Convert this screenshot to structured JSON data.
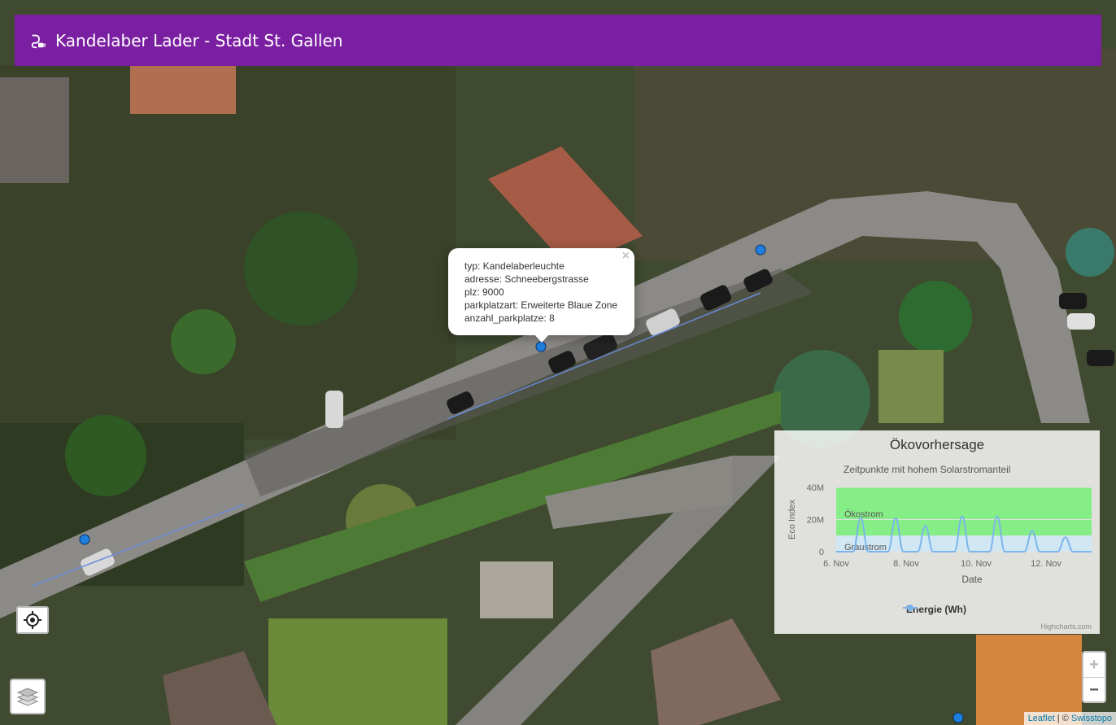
{
  "header": {
    "title": "Kandelaber Lader - Stadt St. Gallen"
  },
  "popup": {
    "lines": [
      "typ: Kandelaberleuchte",
      "adresse: Schneebergstrasse",
      "plz: 9000",
      "parkplatzart: Erweiterte Blaue Zone",
      "anzahl_parkplatze: 8"
    ],
    "close": "×"
  },
  "zoom": {
    "in": "+",
    "out": "−"
  },
  "attribution": {
    "leaflet": "Leaflet",
    "sep": " | © ",
    "provider": "Swisstopo"
  },
  "chart_data": {
    "type": "area",
    "title": "Ökovorhersage",
    "subtitle": "Zeitpunkte mit hohem Solarstromanteil",
    "ylabel": "Eco Index",
    "xlabel": "Date",
    "ytick_labels": [
      "0",
      "20M",
      "40M"
    ],
    "ylim": [
      0,
      40
    ],
    "x_tick_labels": [
      "6. Nov",
      "8. Nov",
      "10. Nov",
      "12. Nov"
    ],
    "x_tick_days": [
      6,
      8,
      10,
      12
    ],
    "xlim": [
      6,
      13.3
    ],
    "bands": [
      {
        "label": "Ökostrom",
        "from": 10,
        "to": 40,
        "color": "#7cef7c"
      },
      {
        "label": "Graustrom",
        "from": 0,
        "to": 10,
        "color": "#cfe8f5"
      }
    ],
    "series": [
      {
        "name": "Energie (Wh)",
        "color": "#7cb5ec",
        "peaks": [
          {
            "day": 6.7,
            "value": 21
          },
          {
            "day": 7.7,
            "value": 21
          },
          {
            "day": 8.55,
            "value": 16
          },
          {
            "day": 9.6,
            "value": 22
          },
          {
            "day": 10.6,
            "value": 22
          },
          {
            "day": 11.6,
            "value": 13
          },
          {
            "day": 12.55,
            "value": 9
          }
        ]
      }
    ],
    "credit": "Highcharts.com"
  }
}
